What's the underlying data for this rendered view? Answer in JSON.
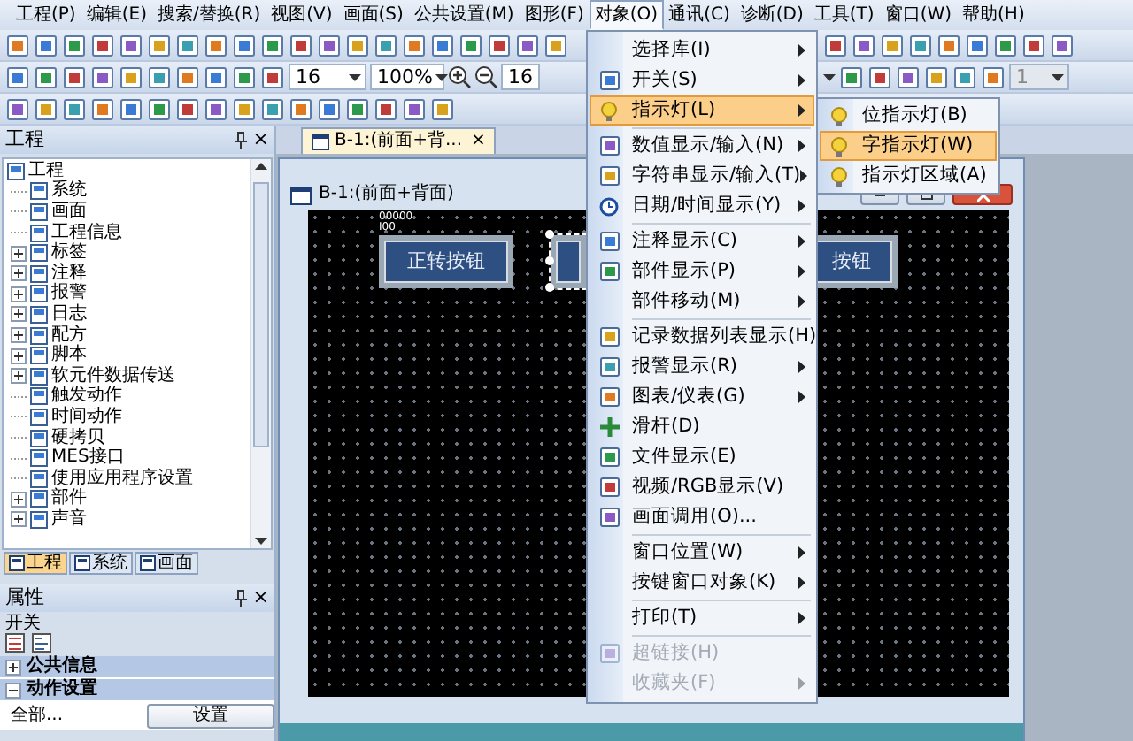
{
  "menu_bar": [
    {
      "label": "工程(P)",
      "selected": false
    },
    {
      "label": "编辑(E)",
      "selected": false
    },
    {
      "label": "搜索/替换(R)",
      "selected": false
    },
    {
      "label": "视图(V)",
      "selected": false
    },
    {
      "label": "画面(S)",
      "selected": false
    },
    {
      "label": "公共设置(M)",
      "selected": false
    },
    {
      "label": "图形(F)",
      "selected": false
    },
    {
      "label": "对象(O)",
      "selected": true
    },
    {
      "label": "通讯(C)",
      "selected": false
    },
    {
      "label": "诊断(D)",
      "selected": false
    },
    {
      "label": "工具(T)",
      "selected": false
    },
    {
      "label": "窗口(W)",
      "selected": false
    },
    {
      "label": "帮助(H)",
      "selected": false
    }
  ],
  "toolbar": {
    "font_size": "16",
    "zoom": "100%",
    "size": "16",
    "layer": {
      "value": "1",
      "disabled": true
    }
  },
  "project_panel": {
    "title": "工程",
    "close": "×",
    "tree": {
      "label": "工程",
      "children": [
        {
          "label": "系统"
        },
        {
          "label": "画面"
        },
        {
          "label": "工程信息"
        },
        {
          "label": "标签",
          "expanded": false
        },
        {
          "label": "注释",
          "expanded": false
        },
        {
          "label": "报警",
          "expanded": false
        },
        {
          "label": "日志",
          "expanded": false
        },
        {
          "label": "配方",
          "expanded": false
        },
        {
          "label": "脚本",
          "expanded": false
        },
        {
          "label": "软元件数据传送",
          "expanded": false
        },
        {
          "label": "触发动作"
        },
        {
          "label": "时间动作"
        },
        {
          "label": "硬拷贝"
        },
        {
          "label": "MES接口"
        },
        {
          "label": "使用应用程序设置"
        },
        {
          "label": "部件",
          "expanded": false
        },
        {
          "label": "声音",
          "expanded": false
        }
      ]
    },
    "tabs": [
      {
        "label": "工程",
        "selected": true
      },
      {
        "label": "系统",
        "selected": false
      },
      {
        "label": "画面",
        "selected": false
      }
    ]
  },
  "properties_panel": {
    "title": "属性",
    "close": "×",
    "object": "开关",
    "groups": [
      {
        "label": "公共信息",
        "expanded": false
      },
      {
        "label": "动作设置",
        "expanded": true
      }
    ],
    "row": {
      "label": "全部...",
      "button": "设置"
    }
  },
  "document_tab": {
    "label": "B-1:(前面+背...",
    "close": "×"
  },
  "screen_window": {
    "title": "B-1:(前面+背面)",
    "objects": [
      {
        "kind": "button",
        "label": "正转按钮",
        "tag": "00000",
        "device": "I00",
        "selected": false
      },
      {
        "kind": "button",
        "selected": true
      },
      {
        "kind": "button",
        "label": "按钮",
        "selected": false
      }
    ]
  },
  "dropdown_menu": {
    "items": [
      {
        "kind": "item",
        "label": "选择库(I)",
        "icon": false,
        "submenu": true,
        "selected": false,
        "disabled": false
      },
      {
        "kind": "item",
        "label": "开关(S)",
        "icon": true,
        "submenu": true,
        "selected": false,
        "disabled": false
      },
      {
        "kind": "item",
        "label": "指示灯(L)",
        "icon": true,
        "submenu": true,
        "selected": true,
        "disabled": false
      },
      {
        "kind": "separator"
      },
      {
        "kind": "item",
        "label": "数值显示/输入(N)",
        "icon": true,
        "submenu": true,
        "selected": false,
        "disabled": false
      },
      {
        "kind": "item",
        "label": "字符串显示/输入(T)",
        "icon": true,
        "submenu": true,
        "selected": false,
        "disabled": false
      },
      {
        "kind": "item",
        "label": "日期/时间显示(Y)",
        "icon": true,
        "submenu": true,
        "selected": false,
        "disabled": false
      },
      {
        "kind": "separator"
      },
      {
        "kind": "item",
        "label": "注释显示(C)",
        "icon": true,
        "submenu": true,
        "selected": false,
        "disabled": false
      },
      {
        "kind": "item",
        "label": "部件显示(P)",
        "icon": true,
        "submenu": true,
        "selected": false,
        "disabled": false
      },
      {
        "kind": "item",
        "label": "部件移动(M)",
        "icon": false,
        "submenu": true,
        "selected": false,
        "disabled": false
      },
      {
        "kind": "separator"
      },
      {
        "kind": "item",
        "label": "记录数据列表显示(H)",
        "icon": true,
        "submenu": false,
        "selected": false,
        "disabled": false
      },
      {
        "kind": "item",
        "label": "报警显示(R)",
        "icon": true,
        "submenu": true,
        "selected": false,
        "disabled": false
      },
      {
        "kind": "item",
        "label": "图表/仪表(G)",
        "icon": true,
        "submenu": true,
        "selected": false,
        "disabled": false
      },
      {
        "kind": "item",
        "label": "滑杆(D)",
        "icon": true,
        "submenu": false,
        "selected": false,
        "disabled": false
      },
      {
        "kind": "item",
        "label": "文件显示(E)",
        "icon": true,
        "submenu": false,
        "selected": false,
        "disabled": false
      },
      {
        "kind": "item",
        "label": "视频/RGB显示(V)",
        "icon": true,
        "submenu": false,
        "selected": false,
        "disabled": false
      },
      {
        "kind": "item",
        "label": "画面调用(O)...",
        "icon": true,
        "submenu": false,
        "selected": false,
        "disabled": false
      },
      {
        "kind": "separator"
      },
      {
        "kind": "item",
        "label": "窗口位置(W)",
        "icon": false,
        "submenu": true,
        "selected": false,
        "disabled": false
      },
      {
        "kind": "item",
        "label": "按键窗口对象(K)",
        "icon": false,
        "submenu": true,
        "selected": false,
        "disabled": false
      },
      {
        "kind": "separator"
      },
      {
        "kind": "item",
        "label": "打印(T)",
        "icon": false,
        "submenu": true,
        "selected": false,
        "disabled": false
      },
      {
        "kind": "separator"
      },
      {
        "kind": "item",
        "label": "超链接(H)",
        "icon": true,
        "submenu": false,
        "selected": false,
        "disabled": true
      },
      {
        "kind": "item",
        "label": "收藏夹(F)",
        "icon": false,
        "submenu": true,
        "selected": false,
        "disabled": true
      }
    ]
  },
  "submenu": {
    "items": [
      {
        "label": "位指示灯(B)",
        "selected": false
      },
      {
        "label": "字指示灯(W)",
        "selected": true
      },
      {
        "label": "指示灯区域(A)",
        "selected": false
      }
    ]
  }
}
